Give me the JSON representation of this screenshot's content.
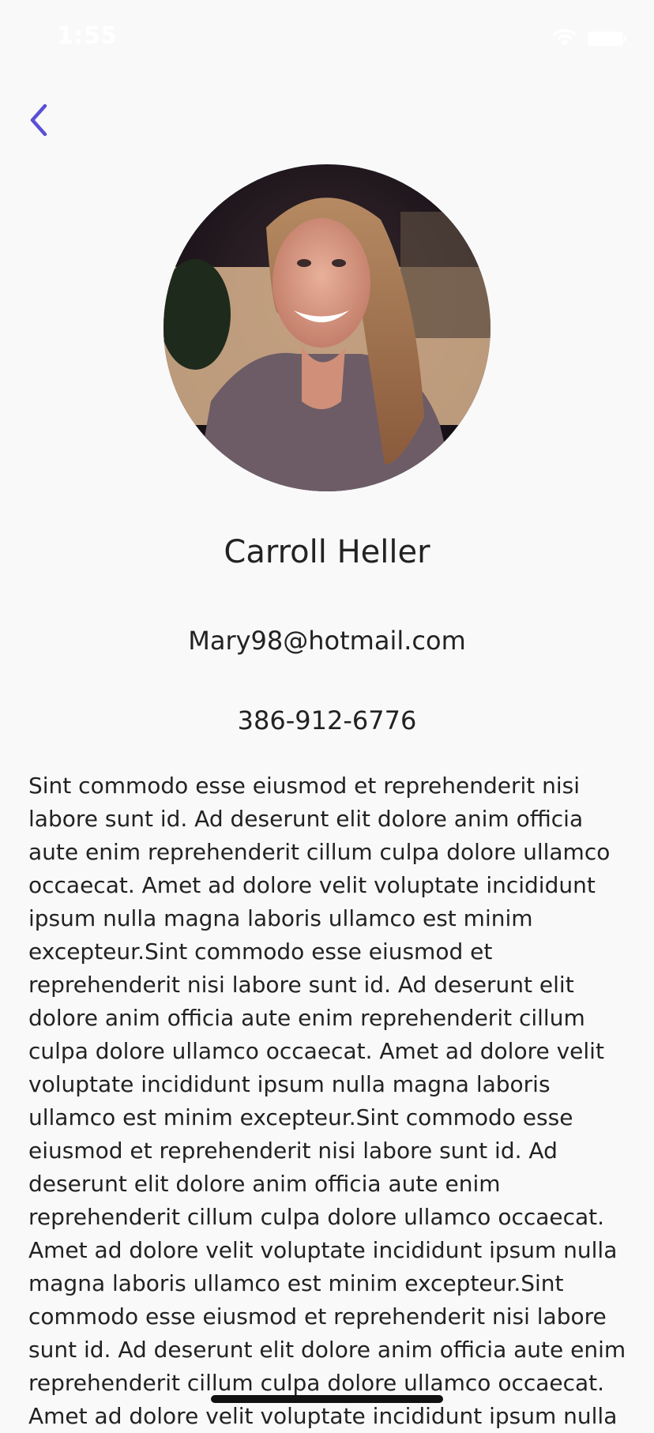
{
  "status_bar": {
    "time": "1:55",
    "wifi_icon": "wifi-icon",
    "battery_icon": "battery-icon"
  },
  "nav": {
    "back_icon": "chevron-left-icon",
    "accent_color": "#5b4fd6"
  },
  "profile": {
    "avatar_icon": "profile-photo",
    "name": "Carroll Heller",
    "email": "Mary98@hotmail.com",
    "phone": "386-912-6776",
    "bio": "Sint commodo esse eiusmod et reprehenderit nisi labore sunt id. Ad deserunt elit dolore anim officia aute enim reprehenderit cillum culpa dolore ullamco occaecat. Amet ad dolore velit voluptate incididunt ipsum nulla magna laboris ullamco est minim excepteur.Sint commodo esse eiusmod et reprehenderit nisi labore sunt id. Ad deserunt elit dolore anim officia aute enim reprehenderit cillum culpa dolore ullamco occaecat. Amet ad dolore velit voluptate incididunt ipsum nulla magna laboris ullamco est minim excepteur.Sint commodo esse eiusmod et reprehenderit nisi labore sunt id. Ad deserunt elit dolore anim officia aute enim reprehenderit cillum culpa dolore ullamco occaecat. Amet ad dolore velit voluptate incididunt ipsum nulla magna laboris ullamco est minim excepteur.Sint commodo esse eiusmod et reprehenderit nisi labore sunt id. Ad deserunt elit dolore anim officia aute enim reprehenderit cillum culpa dolore ullamco occaecat. Amet ad dolore velit voluptate incididunt ipsum nulla"
  }
}
